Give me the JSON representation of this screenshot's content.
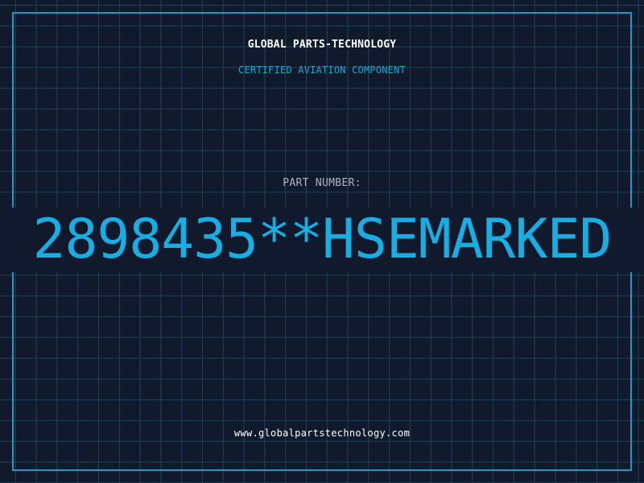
{
  "header": {
    "company": "GLOBAL PARTS-TECHNOLOGY",
    "tagline": "CERTIFIED AVIATION COMPONENT"
  },
  "part": {
    "label": "PART NUMBER:",
    "value": "2898435**HSEMARKED"
  },
  "footer": {
    "website": "www.globalpartstechnology.com"
  },
  "colors": {
    "background": "#111a2d",
    "grid": "#1e4257",
    "accent": "#17aee3",
    "text": "#ffffff",
    "label": "#aab4c3"
  }
}
